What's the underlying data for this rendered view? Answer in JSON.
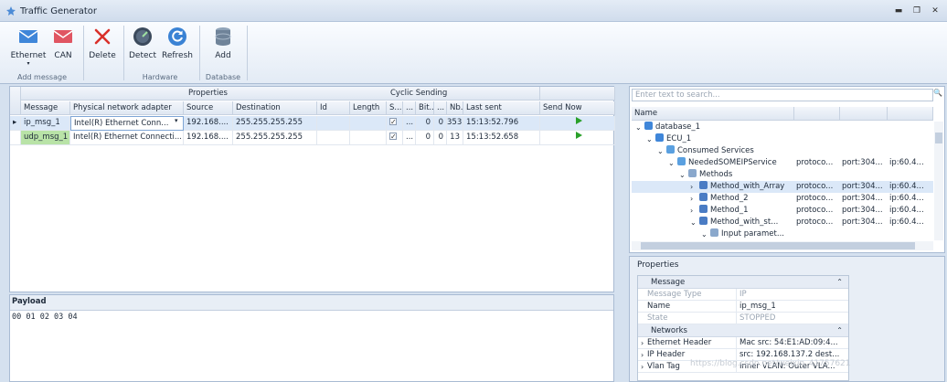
{
  "window": {
    "title": "Traffic Generator",
    "minimize": "▬",
    "restore": "❐",
    "close": "✕"
  },
  "ribbon": {
    "ethernet": "Ethernet",
    "can": "CAN",
    "dropdown_caret": "▾",
    "group_add_message": "Add message",
    "delete": "Delete",
    "detect": "Detect",
    "refresh": "Refresh",
    "group_hardware": "Hardware",
    "add": "Add",
    "group_database": "Database"
  },
  "messages": {
    "band_properties": "Properties",
    "band_cyclic": "Cyclic Sending",
    "columns": [
      "Message",
      "Physical network adapter",
      "Source",
      "Destination",
      "Id",
      "Length",
      "S...",
      "...",
      "Bit...",
      "...",
      "Nb...",
      "Last sent",
      "Send Now"
    ],
    "rows": [
      {
        "indicator": "▸",
        "message": "ip_msg_1",
        "adapter": "Intel(R) Ethernet Conn...",
        "adapter_caret": "▾",
        "source": "192.168....",
        "destination": "255.255.255.255",
        "id": "",
        "length": "",
        "dots1": "...",
        "bit": "0",
        "dots2": "0",
        "nb": "353",
        "last_sent": "15:13:52.796"
      },
      {
        "indicator": "",
        "message": "udp_msg_1",
        "adapter": "Intel(R) Ethernet Connecti...",
        "adapter_caret": "",
        "source": "192.168....",
        "destination": "255.255.255.255",
        "id": "",
        "length": "",
        "dots1": "...",
        "bit": "0",
        "dots2": "0",
        "nb": "13",
        "last_sent": "15:13:52.658"
      }
    ]
  },
  "payload": {
    "label": "Payload",
    "value": "00 01 02 03 04"
  },
  "database_tree": {
    "search_placeholder": "Enter text to search...",
    "search_icon": "🔍",
    "col_name": "Name",
    "nodes": [
      {
        "expander": "⌄",
        "label": "database_1",
        "c1": "",
        "c2": "",
        "c3": ""
      },
      {
        "expander": "⌄",
        "label": "ECU_1",
        "c1": "",
        "c2": "",
        "c3": ""
      },
      {
        "expander": "⌄",
        "label": "Consumed Services",
        "c1": "",
        "c2": "",
        "c3": ""
      },
      {
        "expander": "⌄",
        "label": "NeededSOMEIPService",
        "c1": "protoco...",
        "c2": "port:304...",
        "c3": "ip:60.4..."
      },
      {
        "expander": "⌄",
        "label": "Methods",
        "c1": "",
        "c2": "",
        "c3": ""
      },
      {
        "expander": "›",
        "label": "Method_with_Array",
        "c1": "protoco...",
        "c2": "port:304...",
        "c3": "ip:60.4..."
      },
      {
        "expander": "›",
        "label": "Method_2",
        "c1": "protoco...",
        "c2": "port:304...",
        "c3": "ip:60.4..."
      },
      {
        "expander": "›",
        "label": "Method_1",
        "c1": "protoco...",
        "c2": "port:304...",
        "c3": "ip:60.4..."
      },
      {
        "expander": "⌄",
        "label": "Method_with_st...",
        "c1": "protoco...",
        "c2": "port:304...",
        "c3": "ip:60.4..."
      },
      {
        "expander": "⌄",
        "label": "Input paramet...",
        "c1": "",
        "c2": "",
        "c3": ""
      }
    ]
  },
  "properties": {
    "title": "Properties",
    "groups": [
      {
        "label": "Message",
        "rows": [
          {
            "name": "Message Type",
            "value": "IP",
            "dim": true
          },
          {
            "name": "Name",
            "value": "ip_msg_1",
            "dim": false
          },
          {
            "name": "State",
            "value": "STOPPED",
            "dim": true
          }
        ]
      },
      {
        "label": "Networks",
        "rows": [
          {
            "name": "Ethernet Header",
            "value": "Mac src: 54:E1:AD:09:4...",
            "dim": false
          },
          {
            "name": "IP Header",
            "value": "src: 192.168.137.2 dest...",
            "dim": false
          },
          {
            "name": "Vlan Tag",
            "value": "Inner VLAN:  Outer VLA...",
            "dim": false
          }
        ]
      }
    ],
    "collapse_glyph": "⌃",
    "expand_glyph": "›"
  },
  "watermark": "https://blog.csdn.net/weixin_41757621",
  "colors": {
    "accent": "#2a6fbf",
    "play": "#2aa02a",
    "row_selected": "#dbe8f8",
    "message_cell": "#b9e3a7"
  }
}
